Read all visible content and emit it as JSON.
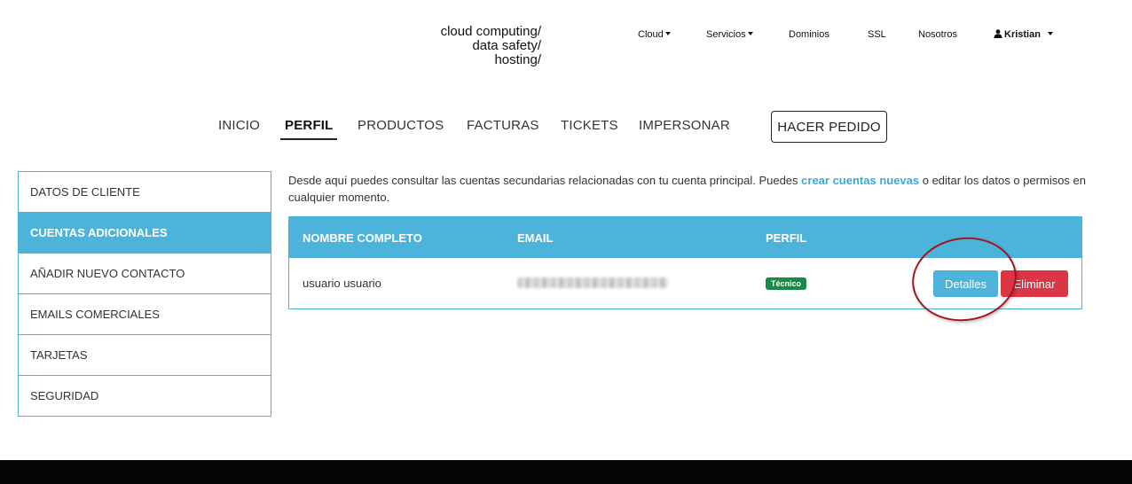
{
  "logo": {
    "line1": "cloud computing/",
    "line2": "data safety/",
    "line3": "hosting/"
  },
  "topnav": {
    "cloud": "Cloud",
    "servicios": "Servicios",
    "dominios": "Dominios",
    "ssl": "SSL",
    "nosotros": "Nosotros",
    "user": "Kristian"
  },
  "mainnav": {
    "inicio": "INICIO",
    "perfil": "PERFIL",
    "productos": "PRODUCTOS",
    "facturas": "FACTURAS",
    "tickets": "TICKETS",
    "impersonar": "IMPERSONAR",
    "order_button": "HACER PEDIDO",
    "active_tab": "PERFIL"
  },
  "sidebar": {
    "items": [
      {
        "label": "DATOS DE CLIENTE",
        "active": false
      },
      {
        "label": "CUENTAS ADICIONALES",
        "active": true
      },
      {
        "label": "AÑADIR NUEVO CONTACTO",
        "active": false
      },
      {
        "label": "EMAILS COMERCIALES",
        "active": false
      },
      {
        "label": "TARJETAS",
        "active": false
      },
      {
        "label": "SEGURIDAD",
        "active": false
      }
    ]
  },
  "intro": {
    "text_before": "Desde aquí puedes consultar las cuentas secundarias relacionadas con tu cuenta principal. Puedes ",
    "link": "crear cuentas nuevas",
    "text_after": " o editar los datos o permisos en cualquier momento."
  },
  "table": {
    "headers": {
      "name": "NOMBRE COMPLETO",
      "email": "EMAIL",
      "profile": "PERFIL"
    },
    "rows": [
      {
        "name": "usuario usuario",
        "profile_badge": "Técnico",
        "details_button": "Detalles",
        "delete_button": "Eliminar"
      }
    ]
  },
  "colors": {
    "accent": "#4cb3da",
    "danger": "#dc3545",
    "badge": "#1a8a4a",
    "annotation_circle": "#a5161b",
    "footer": "#050505"
  }
}
